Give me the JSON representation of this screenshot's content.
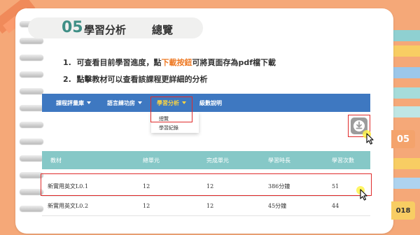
{
  "section": {
    "number": "05",
    "title": "學習分析",
    "subtitle": "總覽"
  },
  "steps": [
    {
      "index": "1.",
      "before": "可查看目前學習進度，點",
      "highlight": "下載按鈕",
      "after": "可將頁面存為pdf檔下載"
    },
    {
      "index": "2.",
      "text": "點擊教材可以查看該課程更詳細的分析"
    }
  ],
  "nav": {
    "items": [
      {
        "label": "課程評量庫"
      },
      {
        "label": "語言練功房"
      },
      {
        "label": "學習分析"
      },
      {
        "label": "級數說明"
      }
    ],
    "dropdown": [
      "總覽",
      "學習紀錄"
    ]
  },
  "download_icon": "download-icon",
  "table": {
    "headers": [
      "教材",
      "總單元",
      "完成單元",
      "學習時長",
      "學習次數"
    ],
    "rows": [
      [
        "新實用英文L0.1",
        "12",
        "12",
        "386分鐘",
        "51"
      ],
      [
        "新實用英文L0.2",
        "12",
        "12",
        "45分鐘",
        "44"
      ]
    ]
  },
  "side_tabs": {
    "chapter": "05",
    "page": "018"
  },
  "colors": {
    "background": "#f5a878",
    "nav": "#3e78c1",
    "table_header": "#86c8c7",
    "accent_teal": "#3f8f86",
    "highlight_orange": "#ee7a25",
    "red_box": "#e02b2b",
    "active_nav": "#ffd640"
  }
}
